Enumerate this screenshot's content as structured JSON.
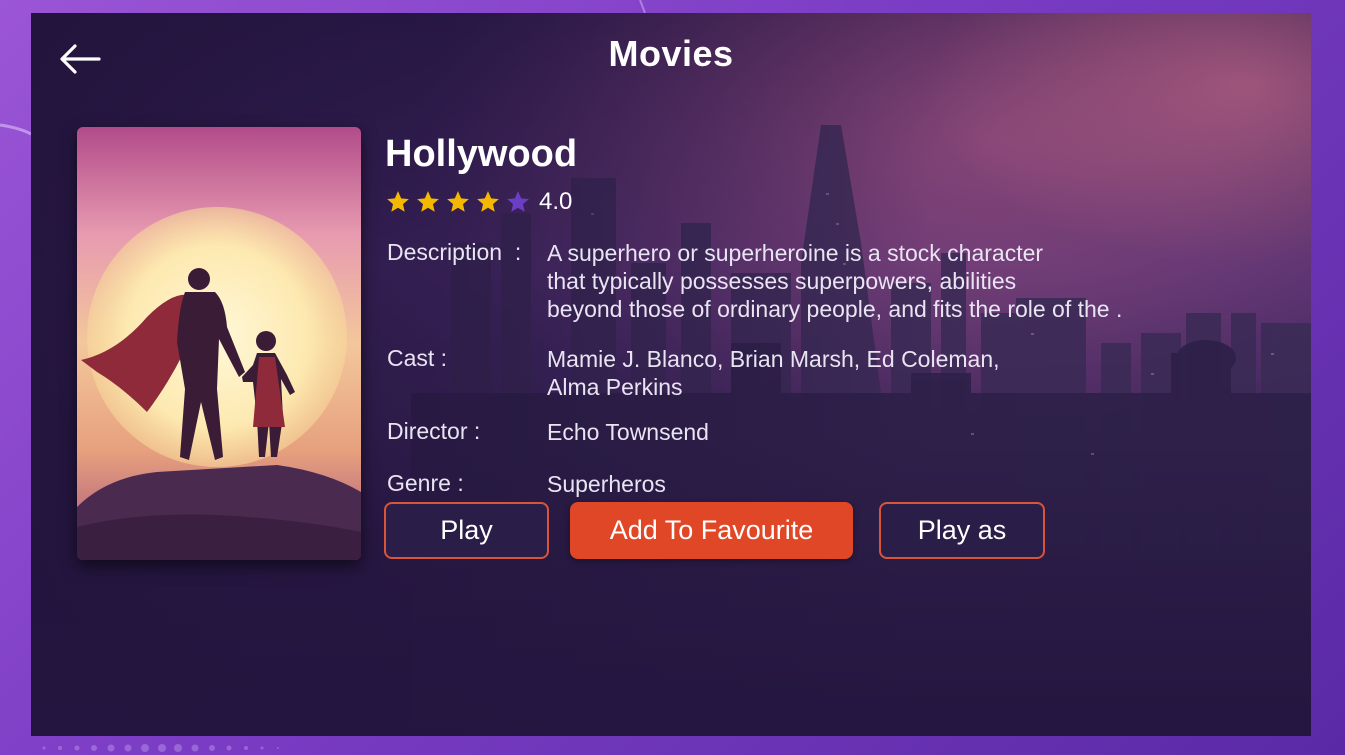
{
  "header": {
    "title": "Movies",
    "back_icon": "arrow-left-icon"
  },
  "movie": {
    "title": "Hollywood",
    "rating": {
      "value_text": "4.0",
      "value": 4.0,
      "max": 5,
      "filled_color": "#f5b800",
      "empty_color": "#6a3fc6"
    },
    "description": {
      "label": "Description",
      "separator": ":",
      "lines": [
        "A superhero or superheroine is a stock character",
        "that typically possesses superpowers, abilities",
        "beyond those of ordinary people, and fits the role of the ."
      ]
    },
    "cast": {
      "label": "Cast :",
      "lines": [
        "Mamie J. Blanco, Brian Marsh,  Ed Coleman,",
        "Alma Perkins"
      ]
    },
    "director": {
      "label": "Director :",
      "value": "Echo Townsend"
    },
    "genre": {
      "label": "Genre :",
      "value": "Superheros"
    }
  },
  "actions": {
    "play_label": "Play",
    "favourite_label": "Add To Favourite",
    "play_as_label": "Play as"
  },
  "colors": {
    "accent": "#e04726",
    "button_border": "#d8553b",
    "background": "#24163f",
    "frame": "#8a48d0"
  }
}
